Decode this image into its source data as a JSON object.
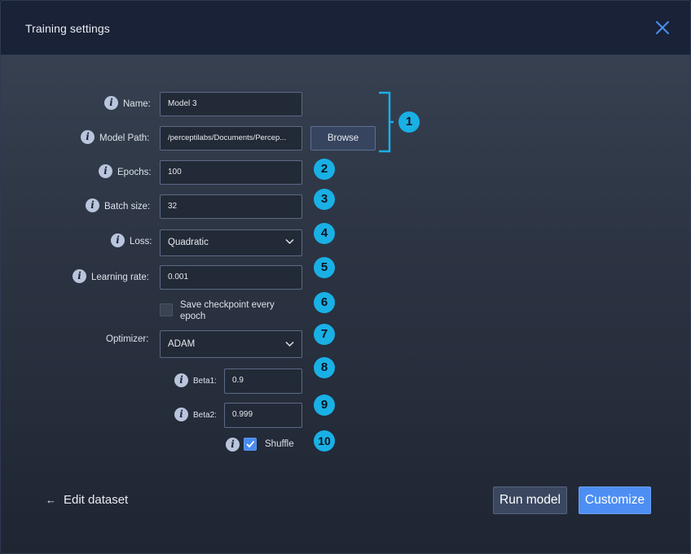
{
  "dialog": {
    "title": "Training settings",
    "close_icon": "close-icon"
  },
  "fields": {
    "name": {
      "label": "Name:",
      "value": "Model 3"
    },
    "model_path": {
      "label": "Model Path:",
      "value": "/perceptilabs/Documents/Percep..."
    },
    "browse_label": "Browse",
    "epochs": {
      "label": "Epochs:",
      "value": "100"
    },
    "batch_size": {
      "label": "Batch size:",
      "value": "32"
    },
    "loss": {
      "label": "Loss:",
      "value": "Quadratic"
    },
    "learning_rate": {
      "label": "Learning rate:",
      "value": "0.001"
    },
    "checkpoint": {
      "label_line1": "Save checkpoint every",
      "label_line2": "epoch",
      "checked": false
    },
    "optimizer": {
      "label": "Optimizer:",
      "value": "ADAM"
    },
    "beta1": {
      "label": "Beta1:",
      "value": "0.9"
    },
    "beta2": {
      "label": "Beta2:",
      "value": "0.999"
    },
    "shuffle": {
      "label": "Shuffle",
      "checked": true
    }
  },
  "info_icon_glyph": "i",
  "badges": [
    "1",
    "2",
    "3",
    "4",
    "5",
    "6",
    "7",
    "8",
    "9",
    "10"
  ],
  "footer": {
    "edit_dataset": "Edit dataset",
    "back_icon": "arrow-left-icon",
    "run_model": "Run model",
    "customize": "Customize"
  },
  "colors": {
    "accent_badge": "#19b0e6",
    "primary_button": "#4d8ef3",
    "header_bg": "#192236"
  }
}
